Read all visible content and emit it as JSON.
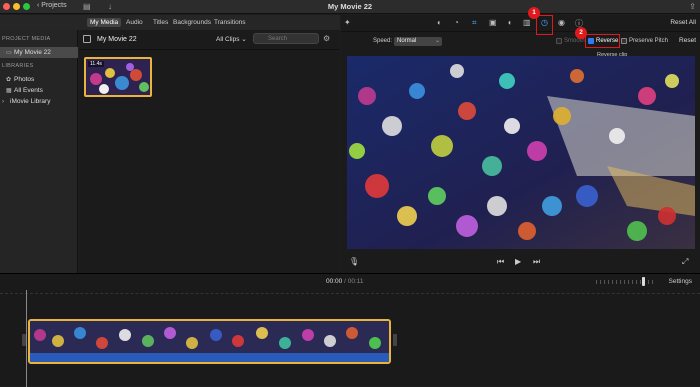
{
  "titlebar": {
    "back_label": "Projects",
    "title": "My Movie 22"
  },
  "tabs": [
    "My Media",
    "Audio",
    "Titles",
    "Backgrounds",
    "Transitions"
  ],
  "sidebar": {
    "section1": "PROJECT MEDIA",
    "project": "My Movie 22",
    "section2": "LIBRARIES",
    "items": [
      "Photos",
      "All Events",
      "iMovie Library"
    ]
  },
  "browser": {
    "title": "My Movie 22",
    "filter": "All Clips",
    "search_placeholder": "Search",
    "clip_duration": "11.4s"
  },
  "viewer": {
    "reset_all": "Reset All",
    "speed_label": "Speed:",
    "speed_value": "Normal",
    "smooth_label": "Smooth",
    "reverse_label": "Reverse",
    "reverse_checked": true,
    "preserve_label": "Preserve Pitch",
    "reset": "Reset",
    "tooltip": "Reverse clip",
    "badge1": "1",
    "badge2": "2"
  },
  "timeline": {
    "current": "00:00",
    "sep": "/",
    "total": "00:11",
    "settings": "Settings"
  },
  "colors": {
    "highlight": "#e0191d",
    "clip_border": "#e9b43b",
    "checkbox": "#2f7bf5"
  }
}
